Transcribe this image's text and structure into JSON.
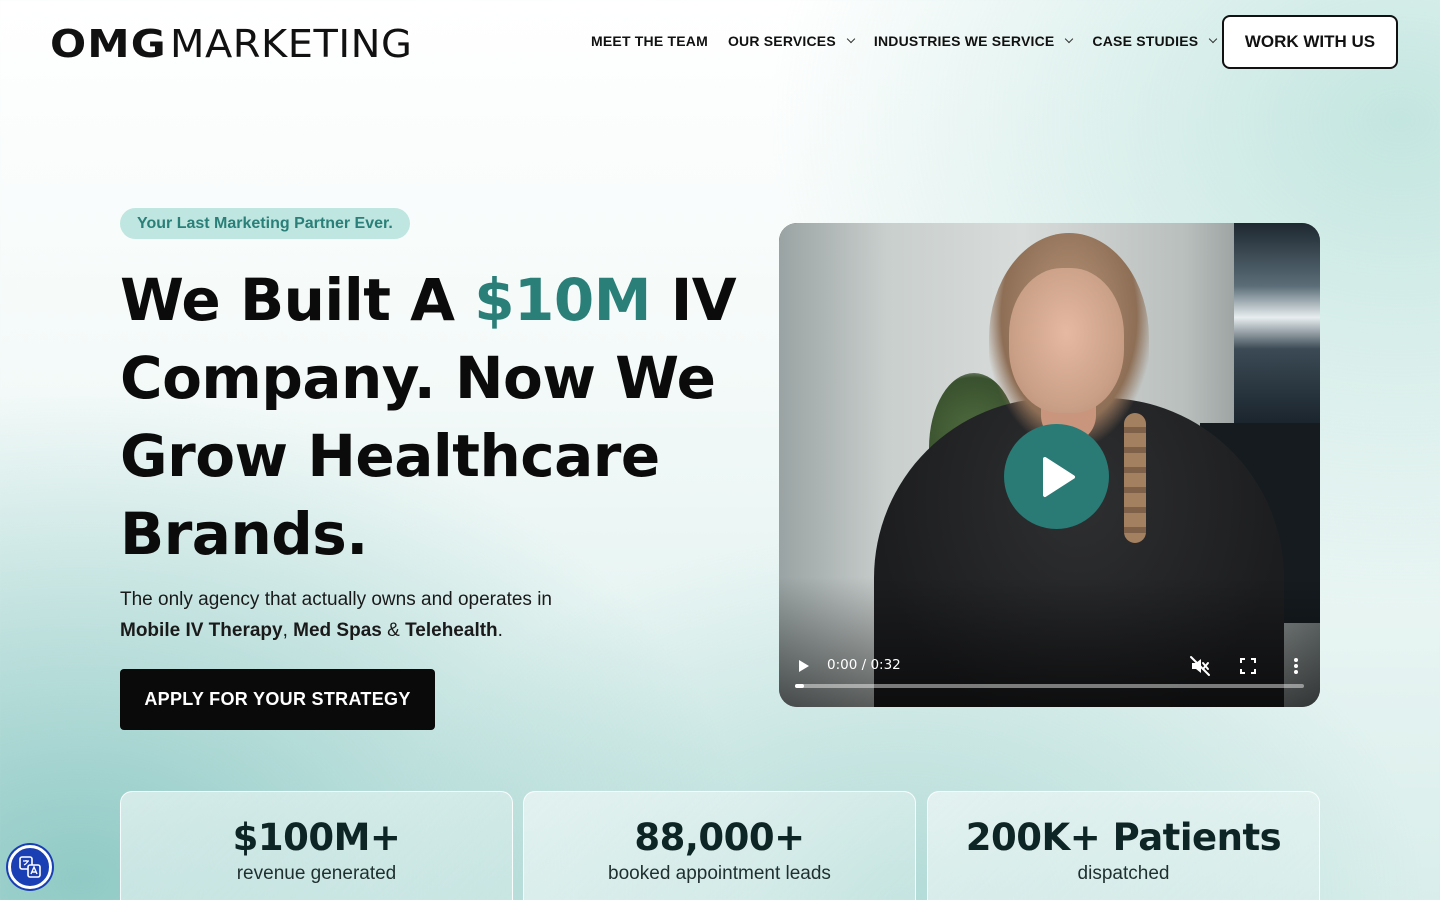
{
  "brand": {
    "logo_bold": "OMG",
    "logo_light": "MARKETING"
  },
  "nav": {
    "items": [
      {
        "label": "MEET THE TEAM",
        "has_dropdown": false
      },
      {
        "label": "OUR SERVICES",
        "has_dropdown": true
      },
      {
        "label": "INDUSTRIES WE SERVICE",
        "has_dropdown": true
      },
      {
        "label": "CASE STUDIES",
        "has_dropdown": true
      }
    ],
    "cta_label": "WORK WITH US"
  },
  "hero": {
    "badge": "Your Last Marketing Partner Ever.",
    "headline_part1": "We Built A ",
    "headline_accent": "$10M",
    "headline_part2": " IV Company. Now We Grow Healthcare Brands.",
    "subtext_intro": "The only agency that actually owns and operates in",
    "subtext_item1": "Mobile IV Therapy",
    "subtext_sep1": ", ",
    "subtext_item2": "Med Spas",
    "subtext_sep2": " & ",
    "subtext_item3": "Telehealth",
    "subtext_end": ".",
    "apply_label": "APPLY FOR YOUR STRATEGY"
  },
  "video": {
    "time_display": "0:00 / 0:32",
    "progress_fraction": 0.0,
    "muted": true
  },
  "stats": [
    {
      "value": "$100M+",
      "label": "revenue generated"
    },
    {
      "value": "88,000+",
      "label": "booked appointment leads"
    },
    {
      "value": "200K+ Patients",
      "label": "dispatched"
    }
  ],
  "colors": {
    "accent": "#2b7f79",
    "badge_bg": "#bfe6e0",
    "button_dark": "#0a0a0a",
    "play_button": "#2a7a75",
    "a11y_button": "#1a3fb4"
  },
  "icons": {
    "play": "play-icon",
    "mute": "volume-muted-icon",
    "fullscreen": "fullscreen-icon",
    "more": "more-vertical-icon",
    "accessibility": "translate-accessibility-icon",
    "dropdown": "chevron-down-icon"
  }
}
